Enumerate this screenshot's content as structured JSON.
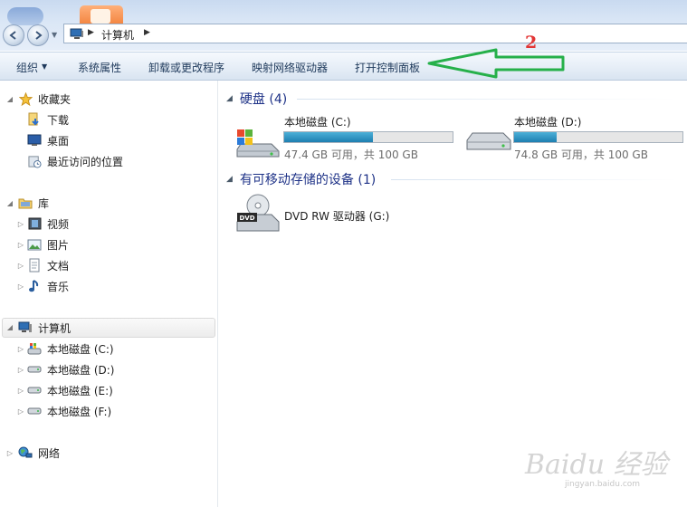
{
  "address_bar": {
    "path": "计算机"
  },
  "command_bar": {
    "organize": "组织",
    "system_properties": "系统属性",
    "uninstall": "卸载或更改程序",
    "map_drive": "映射网络驱动器",
    "open_control_panel": "打开控制面板"
  },
  "annotation": {
    "step_number": "2",
    "arrow_color": "#26b04a",
    "number_color": "#e23535"
  },
  "nav": {
    "favorites": {
      "label": "收藏夹",
      "items": [
        "下载",
        "桌面",
        "最近访问的位置"
      ]
    },
    "libraries": {
      "label": "库",
      "items": [
        "视频",
        "图片",
        "文档",
        "音乐"
      ]
    },
    "computer": {
      "label": "计算机",
      "items": [
        "本地磁盘 (C:)",
        "本地磁盘 (D:)",
        "本地磁盘 (E:)",
        "本地磁盘 (F:)"
      ]
    },
    "network": {
      "label": "网络"
    }
  },
  "content": {
    "hard_disks": {
      "header": "硬盘 (4)",
      "drives": [
        {
          "name": "本地磁盘 (C:)",
          "info": "47.4 GB 可用，共 100 GB",
          "used_fraction": 0.526
        },
        {
          "name": "本地磁盘 (D:)",
          "info": "74.8 GB 可用，共 100 GB",
          "used_fraction": 0.252
        }
      ]
    },
    "removable": {
      "header": "有可移动存储的设备 (1)",
      "devices": [
        {
          "name": "DVD RW 驱动器 (G:)",
          "badge": "DVD"
        }
      ]
    }
  },
  "watermark": {
    "text": "Baidu 经验",
    "sub": "jingyan.baidu.com"
  },
  "colors": {
    "accent": "#1e3287",
    "drive_fill": "#1e7fb0"
  }
}
